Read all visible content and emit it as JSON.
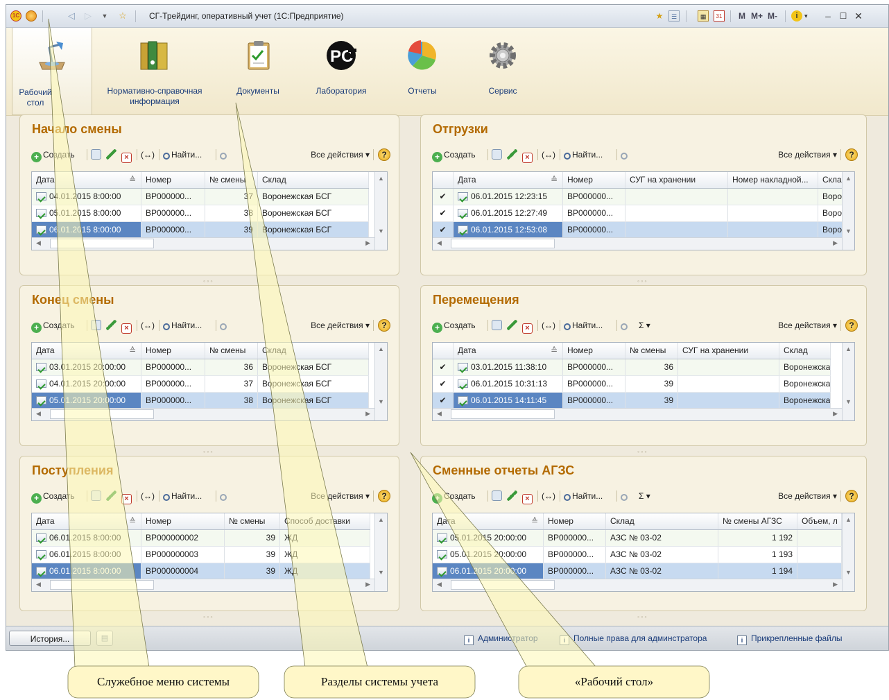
{
  "window": {
    "title": "СГ-Трейдинг, оперативный учет  (1С:Предприятие)",
    "logo_text": "1С",
    "right_icons": [
      "star-icon",
      "favorites-icon",
      "calculator-icon",
      "calendar-icon"
    ],
    "memory_buttons": {
      "m": "M",
      "mplus": "M+",
      "mminus": "M-"
    }
  },
  "sections": [
    {
      "label": "Рабочий стол",
      "icon": "desk-lamp-icon"
    },
    {
      "label": "Нормативно-справочная информация",
      "icon": "binders-icon"
    },
    {
      "label": "Документы",
      "icon": "clipboard-icon"
    },
    {
      "label": "Лаборатория",
      "icon": "rosstest-logo-icon"
    },
    {
      "label": "Отчеты",
      "icon": "pie-chart-icon"
    },
    {
      "label": "Сервис",
      "icon": "gear-icon"
    }
  ],
  "toolbar": {
    "create": "Создать",
    "find": "Найти...",
    "all_actions": "Все действия",
    "sum": "Σ",
    "help": "?",
    "arrows": "(↔)"
  },
  "panels": [
    {
      "title": "Начало смены",
      "columns": [
        "Дата",
        "Номер",
        "№ смены",
        "Склад"
      ],
      "rows": [
        {
          "date": "04.01.2015 8:00:00",
          "number": "ВР000000...",
          "shift": "37",
          "warehouse": "Воронежская БСГ"
        },
        {
          "date": "05.01.2015 8:00:00",
          "number": "ВР000000...",
          "shift": "38",
          "warehouse": "Воронежская БСГ"
        },
        {
          "date": "06.01.2015 8:00:00",
          "number": "ВР000000...",
          "shift": "39",
          "warehouse": "Воронежская БСГ"
        }
      ]
    },
    {
      "title": "Отгрузки",
      "columns": [
        "Дата",
        "Номер",
        "СУГ на хранении",
        "Номер накладной...",
        "Скла,"
      ],
      "rows": [
        {
          "date": "06.01.2015 12:23:15",
          "number": "ВР000000...",
          "stored": "",
          "invoice": "",
          "warehouse": "Bopoi"
        },
        {
          "date": "06.01.2015 12:27:49",
          "number": "ВР000000...",
          "stored": "",
          "invoice": "",
          "warehouse": "Bopoi"
        },
        {
          "date": "06.01.2015 12:53:08",
          "number": "ВР000000...",
          "stored": "",
          "invoice": "",
          "warehouse": "Bopoi"
        }
      ]
    },
    {
      "title": "Конец смены",
      "columns": [
        "Дата",
        "Номер",
        "№ смены",
        "Склад"
      ],
      "rows": [
        {
          "date": "03.01.2015 20:00:00",
          "number": "ВР000000...",
          "shift": "36",
          "warehouse": "Воронежская БСГ"
        },
        {
          "date": "04.01.2015 20:00:00",
          "number": "ВР000000...",
          "shift": "37",
          "warehouse": "Воронежская БСГ"
        },
        {
          "date": "05.01.2015 20:00:00",
          "number": "ВР000000...",
          "shift": "38",
          "warehouse": "Воронежская БСГ"
        }
      ]
    },
    {
      "title": "Перемещения",
      "columns": [
        "Дата",
        "Номер",
        "№ смены",
        "СУГ на хранении",
        "Склад"
      ],
      "rows": [
        {
          "date": "03.01.2015 11:38:10",
          "number": "ВР000000...",
          "shift": "36",
          "stored": "",
          "warehouse": "Воронежская"
        },
        {
          "date": "06.01.2015 10:31:13",
          "number": "ВР000000...",
          "shift": "39",
          "stored": "",
          "warehouse": "Воронежская"
        },
        {
          "date": "06.01.2015 14:11:45",
          "number": "ВР000000...",
          "shift": "39",
          "stored": "",
          "warehouse": "Воронежская"
        }
      ]
    },
    {
      "title": "Поступления",
      "columns": [
        "Дата",
        "Номер",
        "№ смены",
        "Способ доставки"
      ],
      "rows": [
        {
          "date": "06.01.2015 8:00:00",
          "number": "ВР000000002",
          "shift": "39",
          "delivery": "ЖД"
        },
        {
          "date": "06.01.2015 8:00:00",
          "number": "ВР000000003",
          "shift": "39",
          "delivery": "ЖД"
        },
        {
          "date": "06.01.2015 8:00:00",
          "number": "ВР000000004",
          "shift": "39",
          "delivery": "ЖД"
        }
      ]
    },
    {
      "title": "Сменные отчеты АГЗС",
      "columns": [
        "Дата",
        "Номер",
        "Склад",
        "№ смены АГЗС",
        "Объем, л"
      ],
      "rows": [
        {
          "date": "05.01.2015 20:00:00",
          "number": "ВР000000...",
          "warehouse": "АЗС № 03-02",
          "shift": "1 192",
          "volume": ""
        },
        {
          "date": "05.01.2015 20:00:00",
          "number": "ВР000000...",
          "warehouse": "АЗС № 03-02",
          "shift": "1 193",
          "volume": ""
        },
        {
          "date": "06.01.2015 20:00:00",
          "number": "ВР000000...",
          "warehouse": "АЗС № 03-02",
          "shift": "1 194",
          "volume": ""
        }
      ]
    }
  ],
  "statusbar": {
    "history": "История...",
    "user": "Администратор",
    "rights": "Полные права для админстратора",
    "attached": "Прикрепленные файлы"
  },
  "callouts": [
    {
      "label": "Служебное меню системы"
    },
    {
      "label": "Разделы системы учета"
    },
    {
      "label": "«Рабочий стол»"
    }
  ]
}
